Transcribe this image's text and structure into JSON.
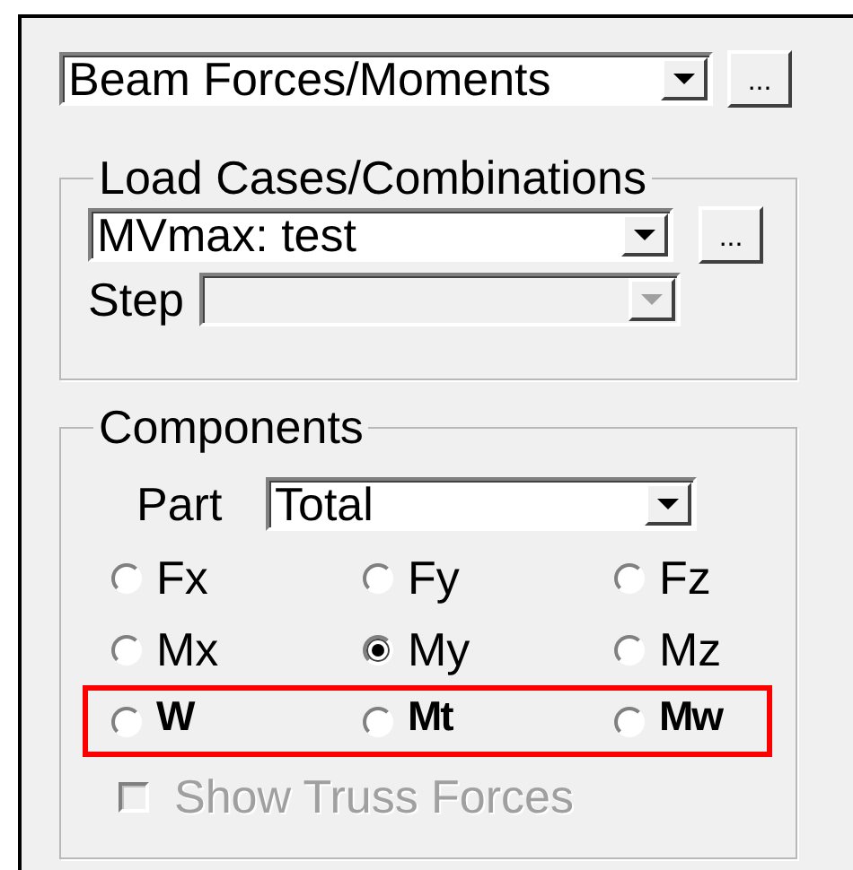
{
  "result_type": {
    "value": "Beam Forces/Moments",
    "button": "..."
  },
  "load_cases": {
    "title": "Load Cases/Combinations",
    "value": "MVmax: test",
    "button": "...",
    "step_label": "Step",
    "step_disabled": true
  },
  "components": {
    "title": "Components",
    "part_label": "Part",
    "part_value": "Total",
    "rows": [
      {
        "highlighted": false,
        "options": [
          {
            "label": "Fx",
            "selected": false
          },
          {
            "label": "Fy",
            "selected": false
          },
          {
            "label": "Fz",
            "selected": false
          }
        ]
      },
      {
        "highlighted": false,
        "options": [
          {
            "label": "Mx",
            "selected": false
          },
          {
            "label": "My",
            "selected": true
          },
          {
            "label": "Mz",
            "selected": false
          }
        ]
      },
      {
        "highlighted": true,
        "options": [
          {
            "label": "W",
            "selected": false
          },
          {
            "label": "Mt",
            "selected": false
          },
          {
            "label": "Mw",
            "selected": false
          }
        ]
      }
    ],
    "show_truss_forces": {
      "label": "Show Truss Forces",
      "checked": false,
      "disabled": true
    }
  }
}
